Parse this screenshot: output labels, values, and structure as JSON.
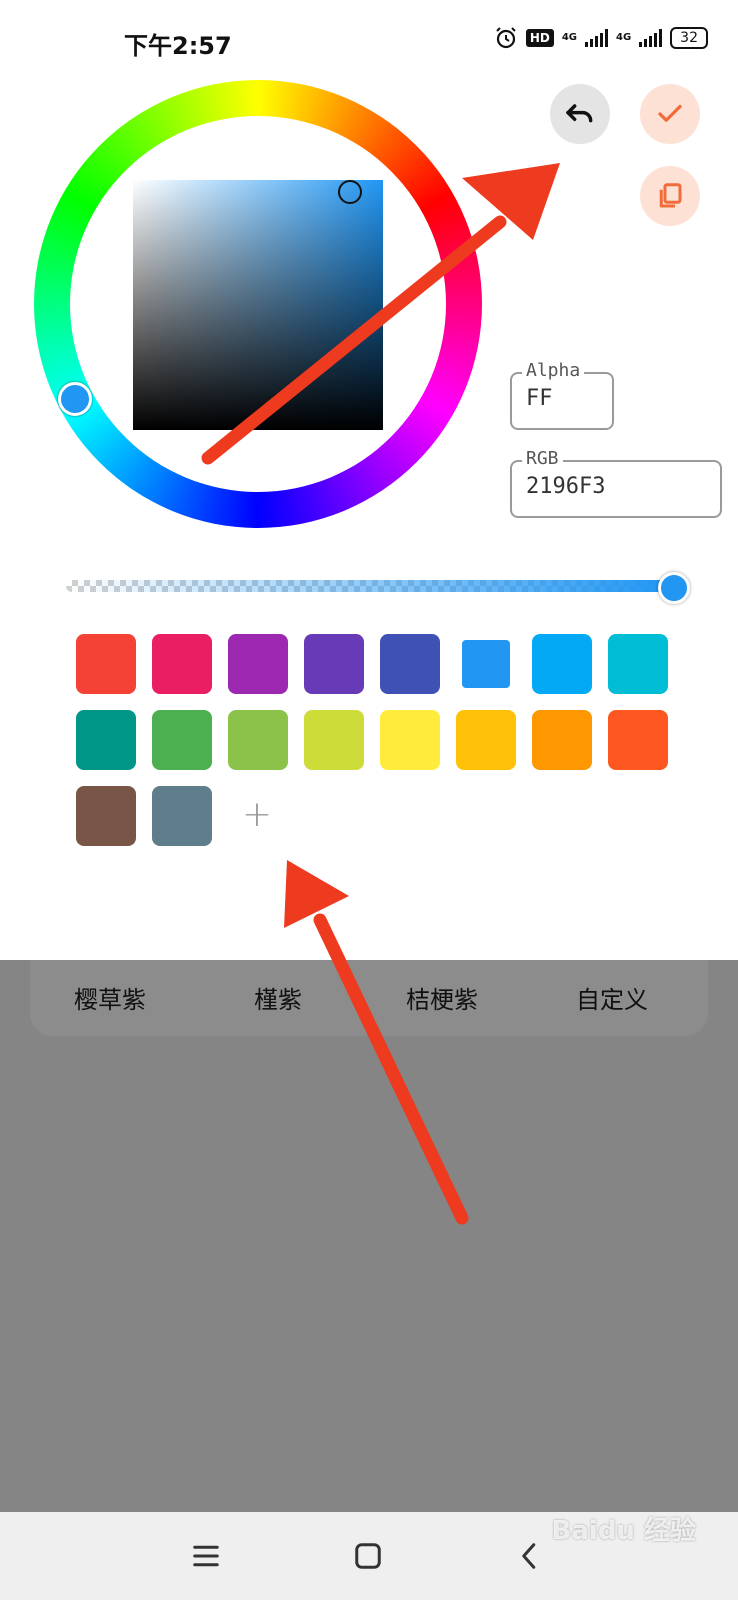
{
  "status_bar": {
    "time": "下午2:57",
    "hd_label": "HD",
    "network1": "4G",
    "network2": "4G",
    "battery": "32"
  },
  "actions": {
    "undo_icon": "undo-icon",
    "confirm_icon": "check-icon",
    "copy_icon": "copy-icon",
    "accent_color": "#F26B3A"
  },
  "picker": {
    "selected_color": "#2196F3",
    "alpha_label": "Alpha",
    "alpha_value": "FF",
    "rgb_label": "RGB",
    "rgb_value": "2196F3",
    "alpha_level": 1.0
  },
  "swatches": [
    "#F44336",
    "#E91E63",
    "#9C27B0",
    "#673AB7",
    "#3F51B5",
    "#2196F3",
    "#03A9F4",
    "#00BCD4",
    "#009688",
    "#4CAF50",
    "#8BC34A",
    "#CDDC39",
    "#FFEB3B",
    "#FFC107",
    "#FF9800",
    "#FF5722",
    "#795548",
    "#607D8B"
  ],
  "selected_swatch_index": 5,
  "add_swatch_label": "+",
  "tabs": [
    "樱草紫",
    "槿紫",
    "桔梗紫",
    "自定义"
  ],
  "nav": {
    "menu_icon": "menu-icon",
    "home_icon": "home-icon",
    "back_icon": "back-icon"
  },
  "watermark": "Baidu 经验"
}
